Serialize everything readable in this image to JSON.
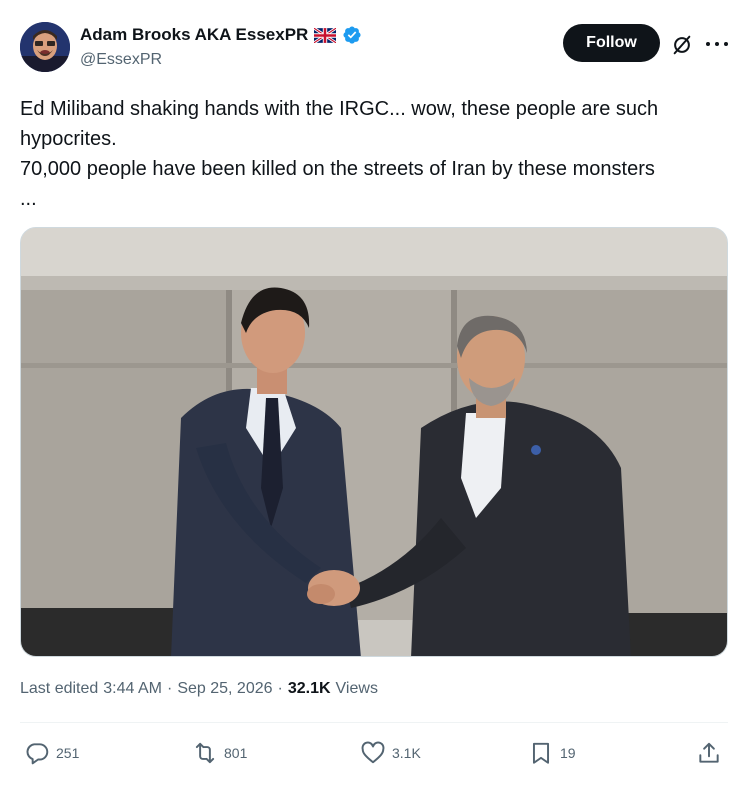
{
  "author": {
    "display_name": "Adam Brooks AKA EssexPR",
    "handle": "@EssexPR",
    "flag_icon": "uk-flag-icon",
    "verified_icon": "verified-badge-icon",
    "verified_color": "#1d9bf0"
  },
  "header": {
    "follow_label": "Follow",
    "grok_icon": "grok-icon",
    "more_icon": "more-icon"
  },
  "tweet": {
    "lines": [
      "Ed Miliband shaking hands with the IRGC... wow, these people are such",
      "hypocrites.",
      "70,000 people have been killed on the streets of Iran by these monsters",
      "..."
    ]
  },
  "meta": {
    "edited_prefix": "Last edited",
    "time": "3:44 AM",
    "separator": "·",
    "date": "Sep 25, 2026",
    "views_count": "32.1K",
    "views_label": "Views"
  },
  "actions": {
    "replies": "251",
    "reposts": "801",
    "likes": "3.1K",
    "bookmarks": "19"
  },
  "colors": {
    "text_primary": "#0f1419",
    "text_secondary": "#536471",
    "follow_bg": "#0f1419",
    "border": "#cfd9de"
  }
}
